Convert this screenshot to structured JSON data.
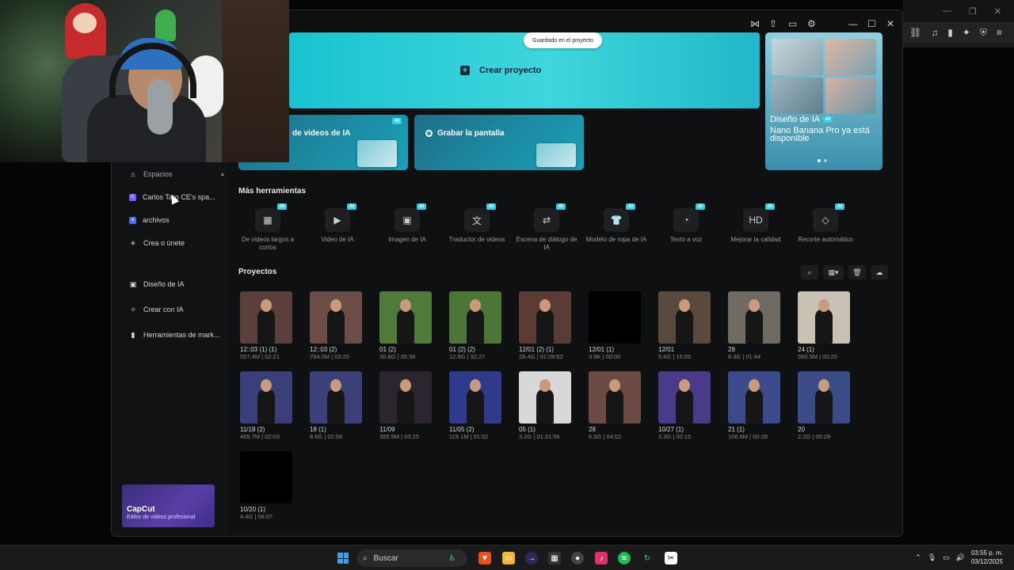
{
  "window": {
    "saved_status": "Guardado en el proyecto"
  },
  "hero": {
    "create_label": "Crear proyecto"
  },
  "cards": [
    {
      "label": "de videos de IA",
      "badge": "AI"
    },
    {
      "label": "Grabar la pantalla"
    }
  ],
  "side_promo": {
    "category": "Diseño de IA",
    "badge": "AI",
    "description": "Nano Banana Pro ya está disponible"
  },
  "sidebar": {
    "section": "Espacios",
    "items": [
      {
        "label": "Carlos Taro CE's spa...",
        "icon": "space-c-icon",
        "color": "#7b5cff",
        "initial": "C"
      },
      {
        "label": "archivos",
        "icon": "space-a-icon",
        "color": "#4a6cf7",
        "initial": "a"
      },
      {
        "label": "Crea o únete",
        "icon": "plus-icon"
      },
      {
        "label": "Diseño de IA",
        "icon": "image-design-icon"
      },
      {
        "label": "Crear con IA",
        "icon": "sparkle-icon"
      },
      {
        "label": "Herramientas de mark...",
        "icon": "marketing-tools-icon"
      }
    ],
    "promo_title": "CapCut",
    "promo_subtitle": "Editor de videos profesional"
  },
  "tools": {
    "title": "Más herramientas",
    "items": [
      {
        "label": "De videos largos a cortos",
        "icon": "long-to-short-icon",
        "glyph": "▦"
      },
      {
        "label": "Video de IA",
        "icon": "ai-video-icon",
        "glyph": "▶"
      },
      {
        "label": "Imagen de IA",
        "icon": "ai-image-icon",
        "glyph": "▣"
      },
      {
        "label": "Traductor de videos",
        "icon": "translate-icon",
        "glyph": "文"
      },
      {
        "label": "Escena de diálogo de IA",
        "icon": "dialogue-scene-icon",
        "glyph": "⇄"
      },
      {
        "label": "Modelo de ropa de IA",
        "icon": "clothing-model-icon",
        "glyph": "👕"
      },
      {
        "label": "Texto a voz",
        "icon": "text-to-speech-icon",
        "glyph": "◔"
      },
      {
        "label": "Mejorar la calidad",
        "icon": "hd-enhance-icon",
        "glyph": "HD"
      },
      {
        "label": "Recorte automático",
        "icon": "auto-cutout-icon",
        "glyph": "◇"
      }
    ],
    "badge": "AI"
  },
  "projects": {
    "title": "Proyectos",
    "items": [
      {
        "name": "12::03 (1) (1)",
        "meta": "557.4M | 02:21",
        "bg": "#5a3f3a"
      },
      {
        "name": "12::03 (2)",
        "meta": "794.0M | 03:20",
        "bg": "#6a4d44"
      },
      {
        "name": "01 (2)",
        "meta": "30.8G | 35:38",
        "bg": "#4f7a3a"
      },
      {
        "name": "01 (2) (2)",
        "meta": "12.8G | 32:27",
        "bg": "#4b7637"
      },
      {
        "name": "12/01 (2) (1)",
        "meta": "28.4G | 01:09:52",
        "bg": "#5a3c34"
      },
      {
        "name": "12/01 (1)",
        "meta": "3.9K | 00:00",
        "bg": "#000000"
      },
      {
        "name": "12/01",
        "meta": "5.6G | 15:05",
        "bg": "#5a4a3e"
      },
      {
        "name": "28",
        "meta": "8.3G | 01:44",
        "bg": "#6f6a62"
      },
      {
        "name": "24 (1)",
        "meta": "560.5M | 00:25",
        "bg": "#c9c1b3"
      },
      {
        "name": "11/18 (2)",
        "meta": "465.7M | 02:03",
        "bg": "#3a3f7a"
      },
      {
        "name": "18 (1)",
        "meta": "8.6G | 02:08",
        "bg": "#3b4078"
      },
      {
        "name": "11/09",
        "meta": "355.5M | 03:25",
        "bg": "#2c2530"
      },
      {
        "name": "11/05 (2)",
        "meta": "119.1M | 01:02",
        "bg": "#2f3a8a"
      },
      {
        "name": "05 (1)",
        "meta": "3.2G | 01:31:56",
        "bg": "#d8d8d8"
      },
      {
        "name": "28",
        "meta": "6.5G | 04:02",
        "bg": "#6a4a42"
      },
      {
        "name": "10/27 (1)",
        "meta": "3.3G | 00:15",
        "bg": "#4a3a8a"
      },
      {
        "name": "21 (1)",
        "meta": "106.6M | 00:28",
        "bg": "#3a4a8a"
      },
      {
        "name": "20",
        "meta": "2.2G | 00:28",
        "bg": "#3b4b88"
      },
      {
        "name": "10/20 (1)",
        "meta": "4.4G | 06:07",
        "bg": "#000000"
      }
    ]
  },
  "taskbar": {
    "search_placeholder": "Buscar",
    "time": "03:55 p. m.",
    "date": "03/12/2025"
  }
}
